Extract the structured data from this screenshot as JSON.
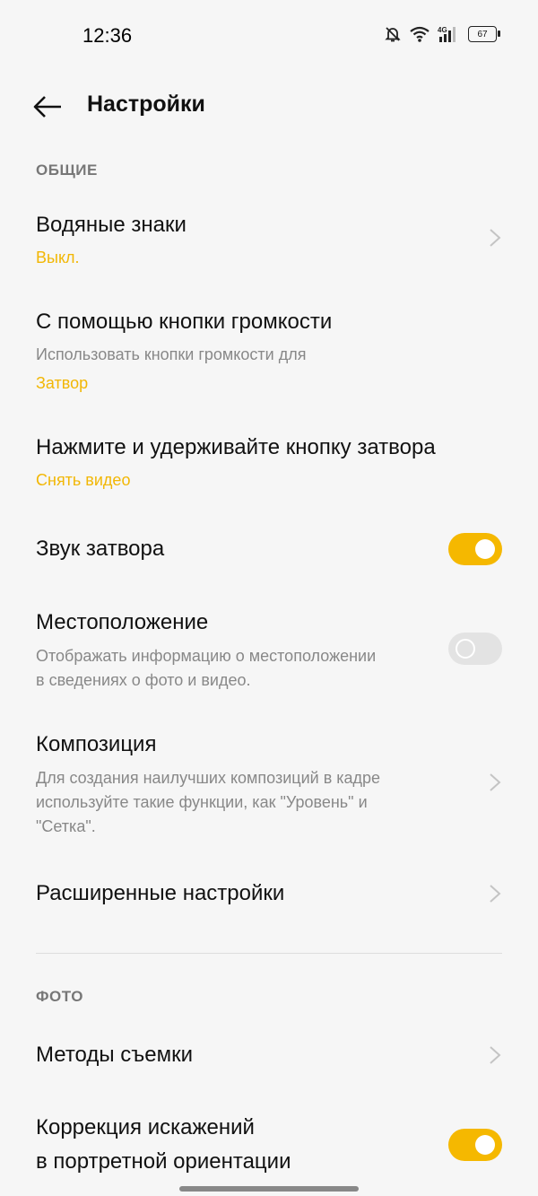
{
  "status_bar": {
    "time": "12:36",
    "network": "4G",
    "battery": "67",
    "icons": [
      "bell-off-icon",
      "wifi-icon",
      "signal-icon",
      "battery-icon"
    ]
  },
  "header": {
    "title": "Настройки",
    "back_icon": "arrow-left-icon"
  },
  "sections": {
    "general": "ОБЩИЕ",
    "photo": "ФОТО"
  },
  "rows": {
    "watermark": {
      "title": "Водяные знаки",
      "value": "Выкл."
    },
    "volume_keys": {
      "title": "С помощью кнопки громкости",
      "subtitle": "Использовать кнопки громкости для",
      "value": "Затвор"
    },
    "hold_shutter": {
      "title": "Нажмите и удерживайте кнопку затвора",
      "value": "Снять видео"
    },
    "shutter_sound": {
      "title": "Звук затвора",
      "enabled": true
    },
    "location": {
      "title": "Местоположение",
      "subtitle_line1": "Отображать информацию о местоположении",
      "subtitle_line2": "в сведениях о фото и видео.",
      "enabled": false
    },
    "composition": {
      "title": "Композиция",
      "subtitle_line1": "Для создания наилучших композиций в кадре",
      "subtitle_line2": "используйте такие функции, как \"Уровень\" и",
      "subtitle_line3": "\"Сетка\"."
    },
    "advanced": {
      "title": "Расширенные настройки"
    },
    "shooting_methods": {
      "title": "Методы съемки"
    },
    "distortion": {
      "title_line1": "Коррекция искажений",
      "title_line2": "в портретной ориентации",
      "enabled": true
    }
  },
  "colors": {
    "accent": "#f5b800",
    "background": "#f6f6f6",
    "text_secondary": "#888888"
  }
}
